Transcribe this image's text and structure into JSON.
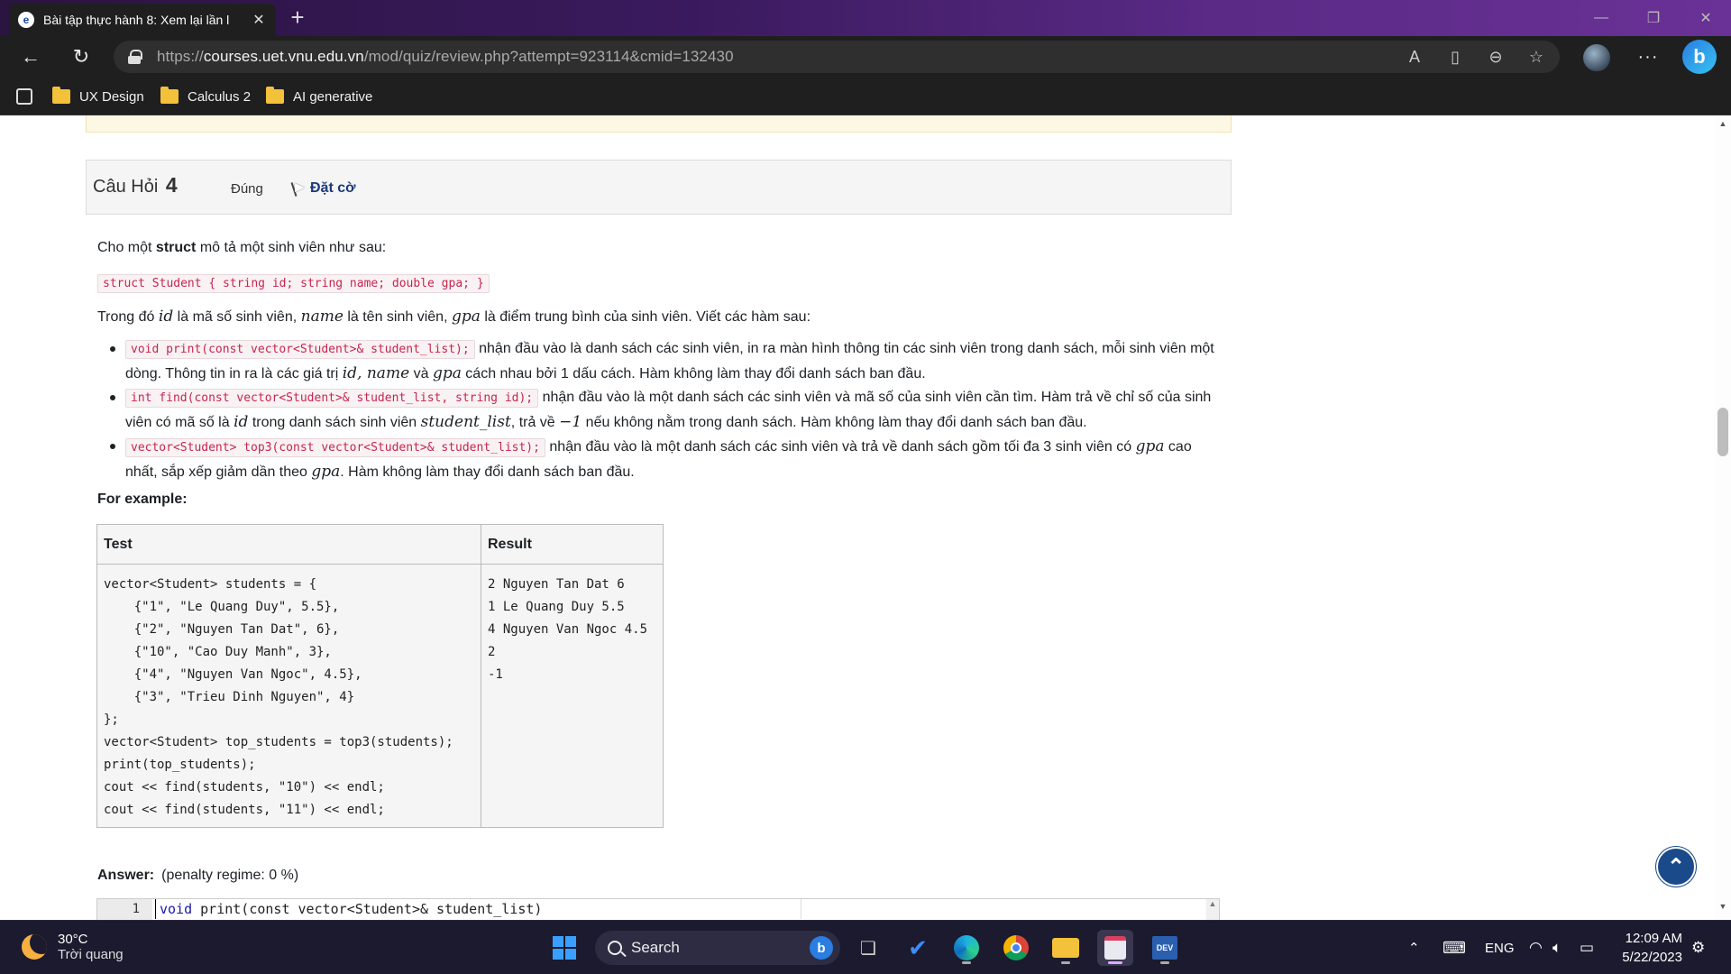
{
  "browser": {
    "tab_title": "Bài tập thực hành 8: Xem lại lần l",
    "url_prefix": "https://",
    "url_domain": "courses.uet.vnu.edu.vn",
    "url_path": "/mod/quiz/review.php?attempt=923114&cmid=132430",
    "bookmarks": [
      "UX Design",
      "Calculus 2",
      "AI generative"
    ]
  },
  "question": {
    "label": "Câu Hỏi",
    "number": "4",
    "state": "Đúng",
    "flag_label": "Đặt cờ",
    "intro_pre": "Cho một ",
    "intro_bold": "struct",
    "intro_post": " mô tả một sinh viên như sau:",
    "struct_code": "struct Student { string id; string name; double gpa; }",
    "where": {
      "p1": "Trong đó ",
      "m1": "id",
      "p2": " là mã số sinh viên, ",
      "m2": "name",
      "p3": " là tên sinh viên, ",
      "m3": "gpa",
      "p4": " là điểm trung bình của sinh viên. Viết các hàm sau:"
    },
    "functions": [
      {
        "code": "void print(const vector<Student>& student_list);",
        "t1": " nhận đầu vào là danh sách các sinh viên, in ra màn hình thông tin các sinh viên trong danh sách, mỗi sinh viên một dòng. Thông tin in ra là các giá trị ",
        "m1": "id, name",
        "t2": " và ",
        "m2": "gpa",
        "t3": " cách nhau bởi 1 dấu cách. Hàm không làm thay đổi danh sách ban đầu."
      },
      {
        "code": "int find(const vector<Student>& student_list, string id);",
        "t1": " nhận đầu vào là một danh sách các sinh viên và mã số của sinh viên cần tìm. Hàm trả về chỉ số của sinh viên có mã số là ",
        "m1": "id",
        "t2": " trong danh sách sinh viên ",
        "m2": "student_list",
        "t3": ", trả về ",
        "m3": "−1",
        "t4": " nếu không nằm trong danh sách. Hàm không làm thay đổi danh sách ban đầu."
      },
      {
        "code": "vector<Student> top3(const vector<Student>& student_list);",
        "t1": " nhận đầu vào là một danh sách các sinh viên và trả về danh sách gồm tối đa 3 sinh viên có ",
        "m1": "gpa",
        "t2": " cao nhất, sắp xếp giảm dần theo ",
        "m2": "gpa",
        "t3": ". Hàm không làm thay đổi danh sách ban đầu."
      }
    ],
    "example_title": "For example:",
    "table": {
      "headers": [
        "Test",
        "Result"
      ],
      "test": "vector<Student> students = {\n    {\"1\", \"Le Quang Duy\", 5.5},\n    {\"2\", \"Nguyen Tan Dat\", 6},\n    {\"10\", \"Cao Duy Manh\", 3},\n    {\"4\", \"Nguyen Van Ngoc\", 4.5},\n    {\"3\", \"Trieu Dinh Nguyen\", 4}\n};\nvector<Student> top_students = top3(students);\nprint(top_students);\ncout << find(students, \"10\") << endl;\ncout << find(students, \"11\") << endl;",
      "result": "2 Nguyen Tan Dat 6\n1 Le Quang Duy 5.5\n4 Nguyen Van Ngoc 4.5\n2\n-1"
    },
    "answer_label": "Answer:",
    "penalty": "(penalty regime: 0 %)",
    "editor": {
      "line_no": "1",
      "kw": "void",
      "line_rest": " print(const vector<Student>& student_list)"
    }
  },
  "taskbar": {
    "temp": "30°C",
    "weather": "Trời quang",
    "search": "Search",
    "lang": "ENG",
    "time": "12:09 AM",
    "date": "5/22/2023"
  }
}
